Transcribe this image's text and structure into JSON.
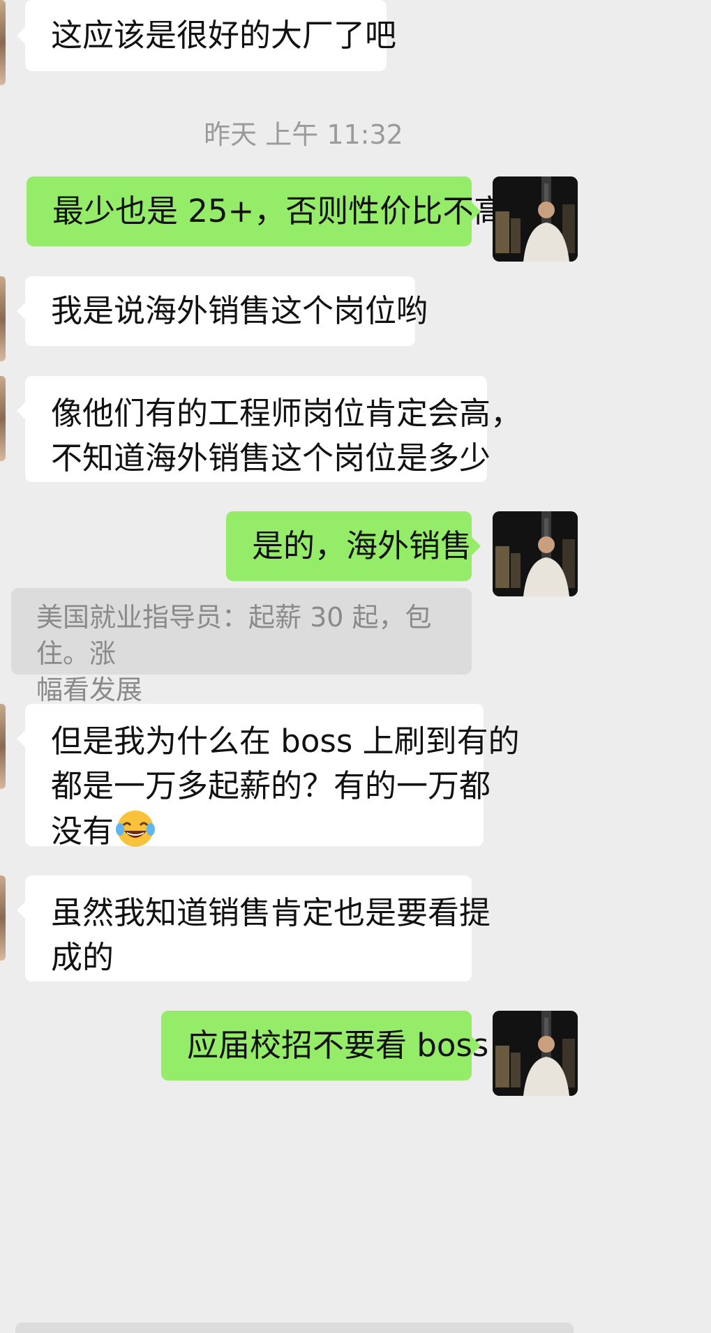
{
  "chat": {
    "timestamp": "昨天 上午 11:32",
    "messages": [
      {
        "side": "in",
        "lines": [
          "这应该是很好的大厂了吧"
        ]
      },
      {
        "side": "out",
        "lines": [
          "最少也是 25+，否则性价比不高"
        ]
      },
      {
        "side": "in",
        "lines": [
          "我是说海外销售这个岗位哟"
        ]
      },
      {
        "side": "in",
        "lines": [
          "像他们有的工程师岗位肯定会高，",
          "不知道海外销售这个岗位是多少"
        ]
      },
      {
        "side": "out",
        "lines": [
          "是的，海外销售"
        ]
      },
      {
        "side": "in",
        "lines": [
          "但是我为什么在 boss 上刷到有的",
          "都是一万多起薪的？有的一万都",
          "没有"
        ],
        "emoji": "tears-of-joy"
      },
      {
        "side": "in",
        "lines": [
          "虽然我知道销售肯定也是要看提",
          "成的"
        ]
      },
      {
        "side": "out",
        "lines": [
          "应届校招不要看 boss"
        ]
      }
    ],
    "system_note": {
      "lines": [
        "美国就业指导员：起薪 30 起，包住。涨",
        "幅看发展"
      ]
    }
  },
  "colors": {
    "background": "#ededed",
    "incoming_bubble": "#ffffff",
    "outgoing_bubble": "#95ec69",
    "system_box": "#dcdcdc",
    "timestamp_text": "#9a9a9a"
  }
}
